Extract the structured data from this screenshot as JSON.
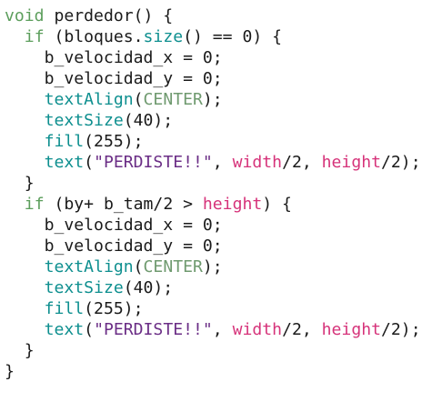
{
  "editor": {
    "colors": {
      "plain": "#1a1a1a",
      "keyword": "#5c9e5c",
      "func": "#0e8f8f",
      "const": "#6f9a6f",
      "string": "#6b2e86",
      "var": "#d6337a",
      "background": "#ffffff"
    },
    "lines": [
      [
        {
          "t": "void",
          "c": "keyword"
        },
        {
          "t": " perdedor() {",
          "c": "plain"
        }
      ],
      [
        {
          "t": "  ",
          "c": "plain"
        },
        {
          "t": "if",
          "c": "keyword"
        },
        {
          "t": " (bloques.",
          "c": "plain"
        },
        {
          "t": "size",
          "c": "func"
        },
        {
          "t": "() == 0) {",
          "c": "plain"
        }
      ],
      [
        {
          "t": "    b_velocidad_x = 0;",
          "c": "plain"
        }
      ],
      [
        {
          "t": "    b_velocidad_y = 0;",
          "c": "plain"
        }
      ],
      [
        {
          "t": "    ",
          "c": "plain"
        },
        {
          "t": "textAlign",
          "c": "func"
        },
        {
          "t": "(",
          "c": "plain"
        },
        {
          "t": "CENTER",
          "c": "const"
        },
        {
          "t": ");",
          "c": "plain"
        }
      ],
      [
        {
          "t": "    ",
          "c": "plain"
        },
        {
          "t": "textSize",
          "c": "func"
        },
        {
          "t": "(40);",
          "c": "plain"
        }
      ],
      [
        {
          "t": "    ",
          "c": "plain"
        },
        {
          "t": "fill",
          "c": "func"
        },
        {
          "t": "(255);",
          "c": "plain"
        }
      ],
      [
        {
          "t": "    ",
          "c": "plain"
        },
        {
          "t": "text",
          "c": "func"
        },
        {
          "t": "(",
          "c": "plain"
        },
        {
          "t": "\"PERDISTE!!\"",
          "c": "string"
        },
        {
          "t": ", ",
          "c": "plain"
        },
        {
          "t": "width",
          "c": "var"
        },
        {
          "t": "/2, ",
          "c": "plain"
        },
        {
          "t": "height",
          "c": "var"
        },
        {
          "t": "/2);",
          "c": "plain"
        }
      ],
      [
        {
          "t": "  }",
          "c": "plain"
        }
      ],
      [
        {
          "t": "  ",
          "c": "plain"
        },
        {
          "t": "if",
          "c": "keyword"
        },
        {
          "t": " (by+ b_tam/2 > ",
          "c": "plain"
        },
        {
          "t": "height",
          "c": "var"
        },
        {
          "t": ") {",
          "c": "plain"
        }
      ],
      [
        {
          "t": "    b_velocidad_x = 0;",
          "c": "plain"
        }
      ],
      [
        {
          "t": "    b_velocidad_y = 0;",
          "c": "plain"
        }
      ],
      [
        {
          "t": "    ",
          "c": "plain"
        },
        {
          "t": "textAlign",
          "c": "func"
        },
        {
          "t": "(",
          "c": "plain"
        },
        {
          "t": "CENTER",
          "c": "const"
        },
        {
          "t": ");",
          "c": "plain"
        }
      ],
      [
        {
          "t": "    ",
          "c": "plain"
        },
        {
          "t": "textSize",
          "c": "func"
        },
        {
          "t": "(40);",
          "c": "plain"
        }
      ],
      [
        {
          "t": "    ",
          "c": "plain"
        },
        {
          "t": "fill",
          "c": "func"
        },
        {
          "t": "(255);",
          "c": "plain"
        }
      ],
      [
        {
          "t": "    ",
          "c": "plain"
        },
        {
          "t": "text",
          "c": "func"
        },
        {
          "t": "(",
          "c": "plain"
        },
        {
          "t": "\"PERDISTE!!\"",
          "c": "string"
        },
        {
          "t": ", ",
          "c": "plain"
        },
        {
          "t": "width",
          "c": "var"
        },
        {
          "t": "/2, ",
          "c": "plain"
        },
        {
          "t": "height",
          "c": "var"
        },
        {
          "t": "/2);",
          "c": "plain"
        }
      ],
      [
        {
          "t": "  }",
          "c": "plain"
        }
      ],
      [
        {
          "t": "}",
          "c": "plain"
        }
      ]
    ]
  }
}
